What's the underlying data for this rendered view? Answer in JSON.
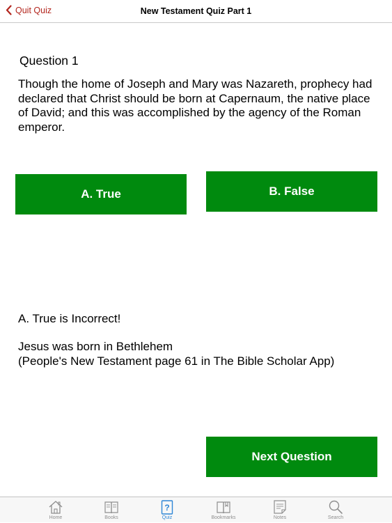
{
  "navbar": {
    "back_label": "Quit Quiz",
    "title": "New Testament Quiz Part 1"
  },
  "question": {
    "number_label": "Question 1",
    "text": "Though the home of Joseph and Mary was Nazareth, prophecy had declared that Christ should be born at Capernaum, the native place of David; and this was accomplished by the agency of the Roman emperor."
  },
  "answers": {
    "a_label": "A. True",
    "b_label": "B. False"
  },
  "result": {
    "status": "A. True is Incorrect!",
    "explanation_line1": "Jesus was born in Bethlehem",
    "explanation_line2": "(People's New Testament page 61 in The Bible Scholar App)"
  },
  "next_button_label": "Next Question",
  "tabs": [
    {
      "label": "Home",
      "icon": "home-icon"
    },
    {
      "label": "Books",
      "icon": "book-icon"
    },
    {
      "label": "Quiz",
      "icon": "quiz-icon"
    },
    {
      "label": "Bookmarks",
      "icon": "bookmarks-icon"
    },
    {
      "label": "Notes",
      "icon": "notes-icon"
    },
    {
      "label": "Search",
      "icon": "search-icon"
    }
  ],
  "active_tab": "Quiz",
  "colors": {
    "accent_red": "#b3261e",
    "button_green": "#008a0e",
    "tab_active": "#2e86d6",
    "tab_inactive": "#8e8e8e"
  }
}
